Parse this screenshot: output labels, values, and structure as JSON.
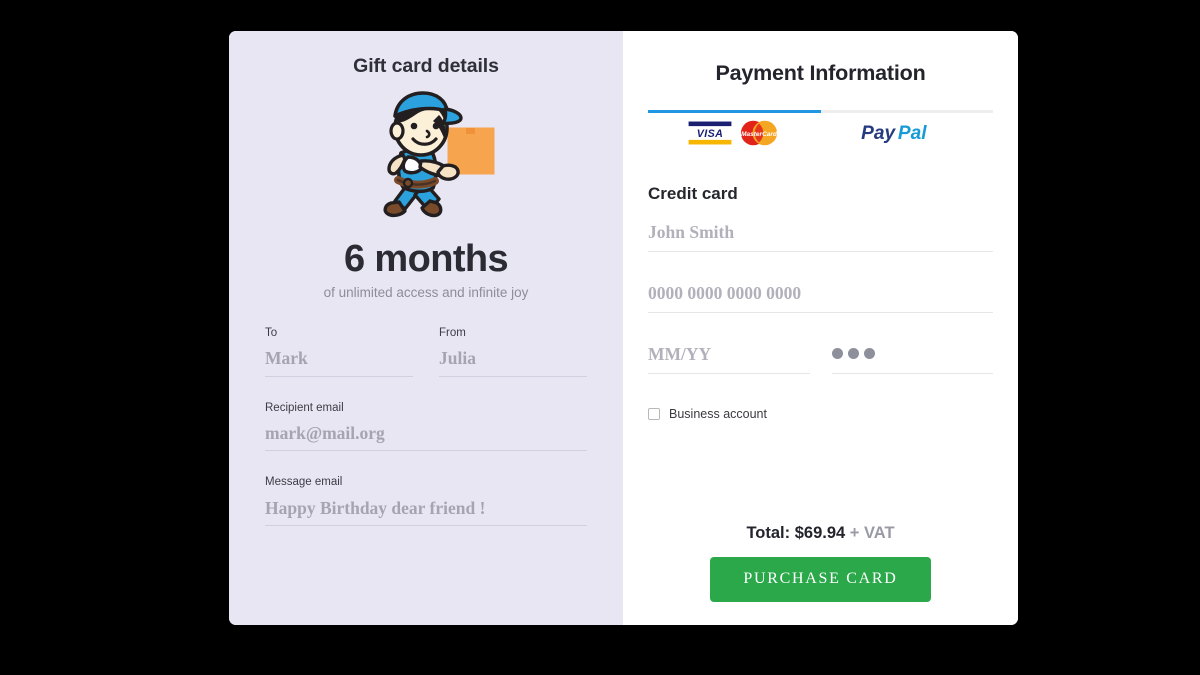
{
  "gift_panel": {
    "title": "Gift card details",
    "illustration_icon": "delivery-man-running-with-parcel-illustration",
    "plan_duration": "6 months",
    "plan_tagline": "of unlimited access and infinite joy",
    "fields": {
      "to": {
        "label": "To",
        "placeholder": "Mark"
      },
      "from": {
        "label": "From",
        "placeholder": "Julia"
      },
      "recipient_email": {
        "label": "Recipient email",
        "placeholder": "mark@mail.org"
      },
      "message_email": {
        "label": "Message email",
        "placeholder": "Happy Birthday dear friend !"
      }
    }
  },
  "payment_panel": {
    "title": "Payment Information",
    "tabs": [
      {
        "id": "card",
        "icons": [
          "visa-logo",
          "mastercard-logo"
        ],
        "active": true
      },
      {
        "id": "paypal",
        "icons": [
          "paypal-logo"
        ],
        "active": false
      }
    ],
    "section_heading": "Credit card",
    "fields": {
      "cardholder": {
        "placeholder": "John Smith"
      },
      "card_number": {
        "placeholder": "0000 0000 0000 0000"
      },
      "expiry": {
        "placeholder": "MM/YY"
      },
      "cvc": {
        "masked_value": "●●●",
        "dot_count": 3
      }
    },
    "business_account": {
      "label": "Business account",
      "checked": false
    },
    "total": {
      "prefix": "Total: $69.94",
      "suffix": " + VAT"
    },
    "purchase_button": "PURCHASE CARD"
  },
  "colors": {
    "page_background": "#000000",
    "gift_panel_background": "#e9e6f3",
    "payment_panel_background": "#ffffff",
    "active_tab_accent": "#2196e3",
    "purchase_button": "#2aa84a",
    "placeholder_text": "#b2b0ba"
  }
}
